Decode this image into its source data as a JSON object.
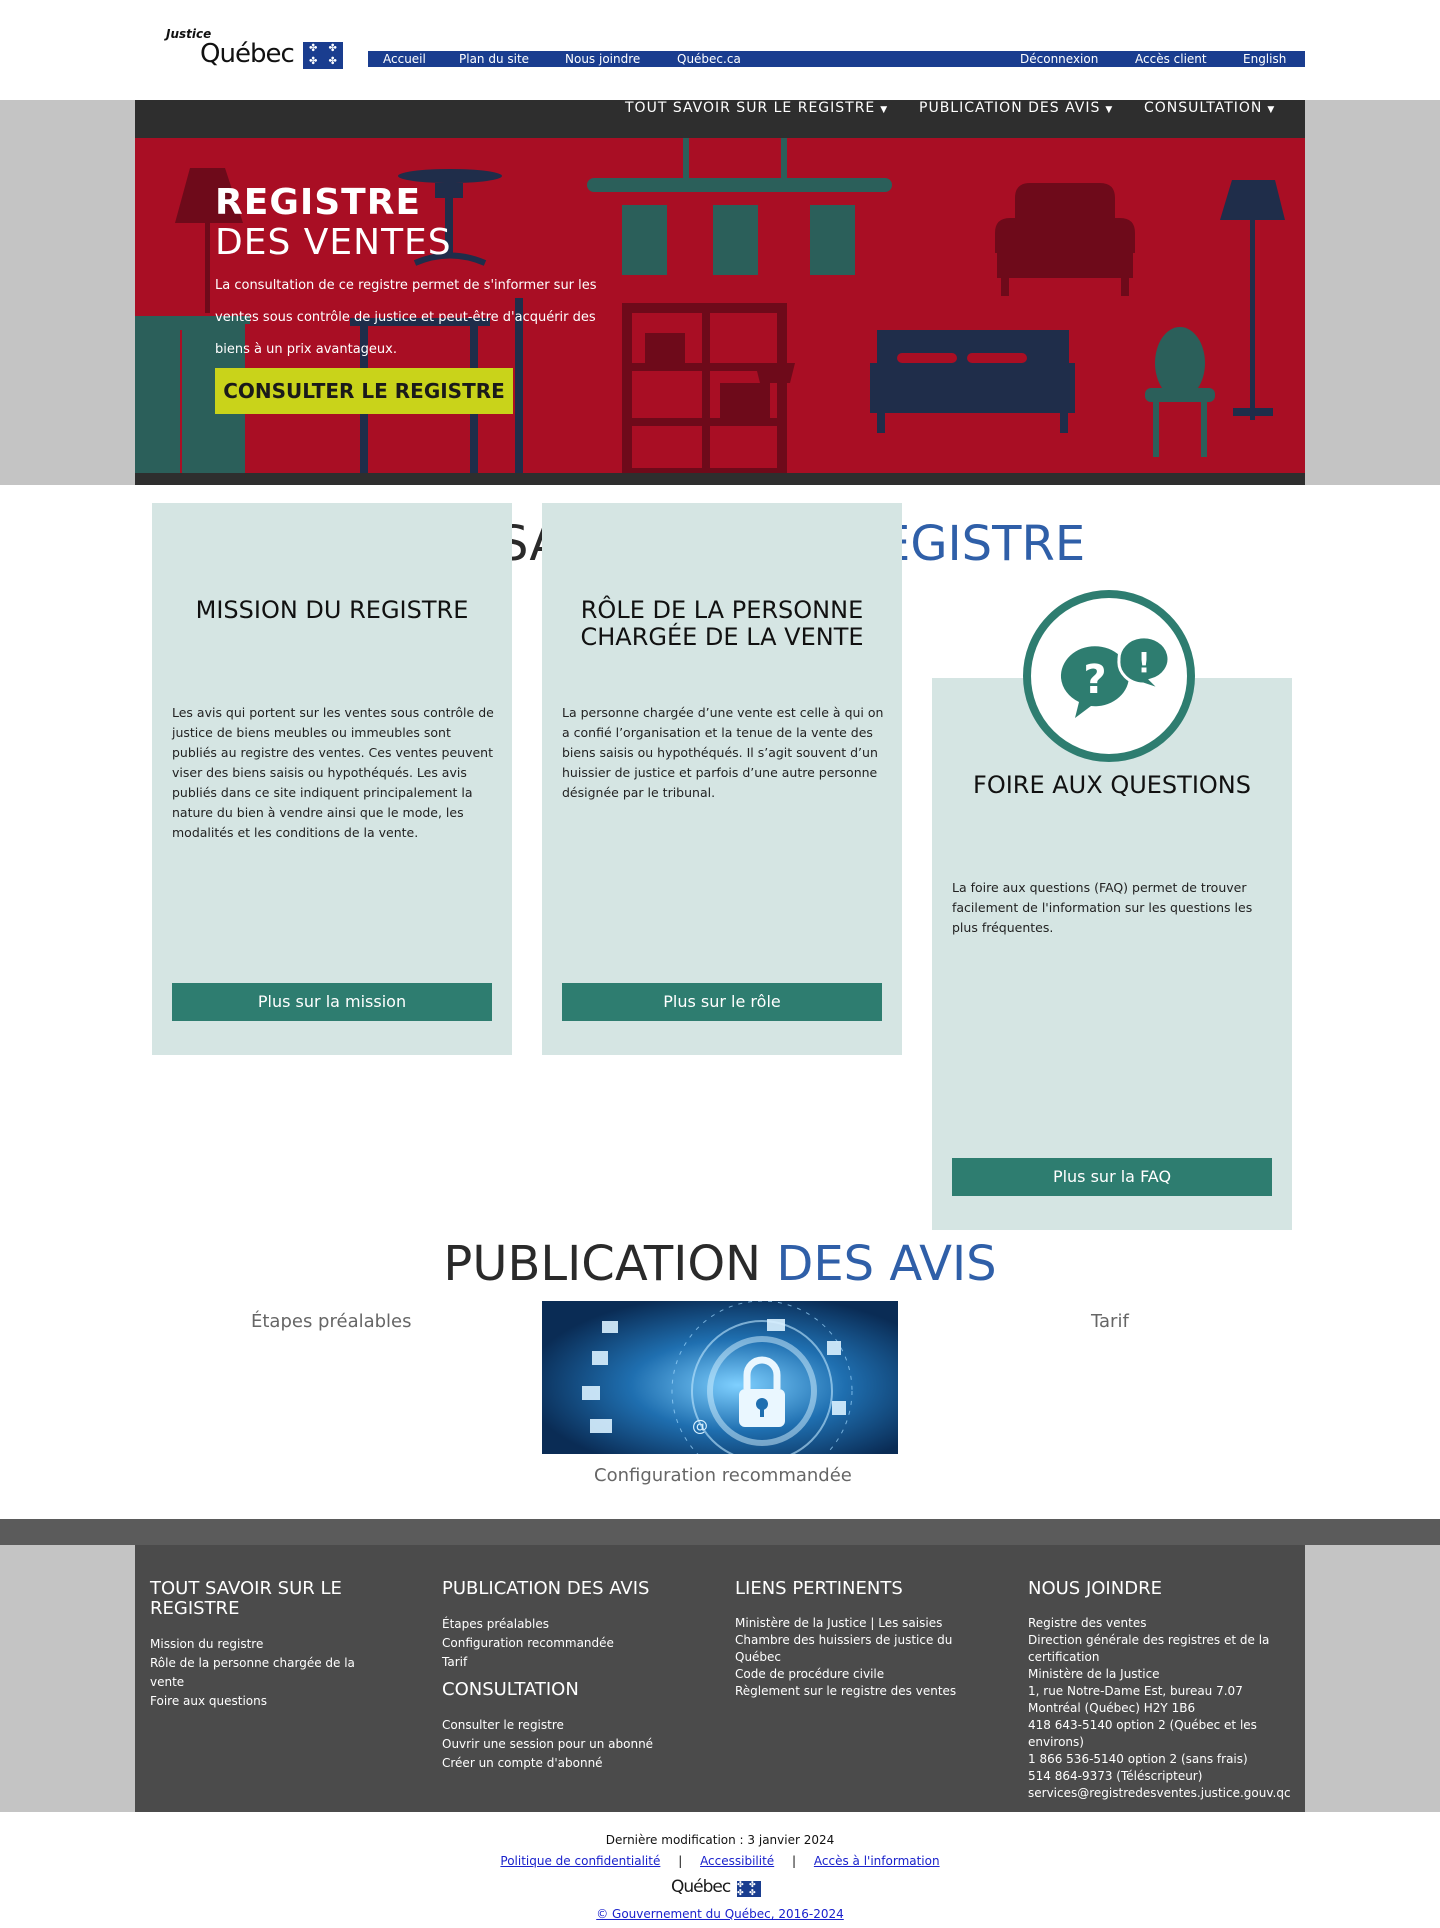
{
  "header": {
    "logo_justice": "Justice",
    "logo_quebec": "Québec",
    "util_links": [
      "Accueil",
      "Plan du site",
      "Nous joindre",
      "Québec.ca"
    ],
    "util_right": [
      "Déconnexion",
      "Accès client",
      "English"
    ]
  },
  "mainnav": {
    "items": [
      "TOUT SAVOIR SUR LE REGISTRE",
      "PUBLICATION DES AVIS",
      "CONSULTATION"
    ]
  },
  "hero": {
    "title_bold": "REGISTRE",
    "title_light": "DES VENTES",
    "intro": "La consultation de ce registre permet de s'informer sur les ventes sous contrôle de justice et peut-être d'acquérir des biens à un prix avantageux.",
    "cta": "CONSULTER LE REGISTRE"
  },
  "section1": {
    "heading_dark_fragment": "SA",
    "heading_blue_fragment": "EGISTRE"
  },
  "cards": [
    {
      "title": "MISSION DU REGISTRE",
      "text": "Les avis qui portent sur les ventes sous contrôle de justice de biens meubles ou immeubles sont publiés au registre des ventes. Ces ventes peuvent viser des biens saisis ou hypothéqués. Les avis publiés dans ce site indiquent principalement la nature du bien à vendre ainsi que le mode, les modalités et les conditions de la vente.",
      "button": "Plus sur la mission"
    },
    {
      "title": "RÔLE DE LA PERSONNE CHARGÉE DE LA VENTE",
      "text": "La personne chargée d’une vente est celle à qui on a confié l’organisation et la tenue de la vente des biens saisis ou hypothéqués. Il s’agit souvent d’un huissier de justice et parfois d’une autre personne désignée par le tribunal.",
      "button": "Plus sur le rôle"
    },
    {
      "title": "FOIRE AUX QUESTIONS",
      "text": "La foire aux questions (FAQ) permet de trouver facilement de l'information sur les questions les plus fréquentes.",
      "button": "Plus sur la FAQ"
    }
  ],
  "publication": {
    "heading_dark": "PUBLICATION",
    "heading_blue": "DES AVIS",
    "links": [
      "Étapes préalables",
      "Tarif",
      "Configuration recommandée"
    ]
  },
  "footer": {
    "col1": {
      "title": "TOUT SAVOIR SUR LE REGISTRE",
      "links": [
        "Mission du registre",
        "Rôle de la personne chargée de la vente",
        "Foire aux questions"
      ]
    },
    "col2": {
      "title": "PUBLICATION DES AVIS",
      "links": [
        "Étapes préalables",
        "Configuration recommandée",
        "Tarif"
      ],
      "title2": "CONSULTATION",
      "links2": [
        "Consulter le registre",
        "Ouvrir une session pour un abonné",
        "Créer un compte d'abonné"
      ]
    },
    "col3": {
      "title": "LIENS PERTINENTS",
      "links": [
        "Ministère de la Justice | Les saisies",
        "Chambre des huissiers de justice du Québec",
        "Code de procédure civile",
        "Règlement sur le registre des ventes"
      ]
    },
    "col4": {
      "title": "NOUS JOINDRE",
      "lines": [
        "Registre des ventes",
        "Direction générale des registres et de la certification",
        "Ministère de la Justice",
        "1, rue Notre-Dame Est, bureau 7.07",
        "Montréal (Québec)  H2Y 1B6",
        "418 643-5140 option 2 (Québec et les environs)",
        "1 866 536-5140 option 2 (sans frais)",
        "514 864-9373 (Téléscripteur)",
        "services@registredesventes.justice.gouv.qc"
      ]
    }
  },
  "bottom": {
    "last_modified": "Dernière modification :  3 janvier 2024",
    "links": [
      "Politique de confidentialité",
      "Accessibilité",
      "Accès à l'information"
    ],
    "separator": "|",
    "logo": "Québec",
    "copyright": "© Gouvernement du Québec, 2016-2024"
  },
  "colors": {
    "gov_blue": "#1a3d8f",
    "hero_red": "#a90e24",
    "teal": "#2e7d70",
    "card_bg": "#d5e5e3",
    "cta_yellow": "#c9d31a",
    "heading_blue": "#2f5fa8"
  },
  "icons": [
    "quebec-flag-icon",
    "caret-down-icon",
    "faq-speech-bubbles-icon",
    "padlock-security-icon"
  ]
}
